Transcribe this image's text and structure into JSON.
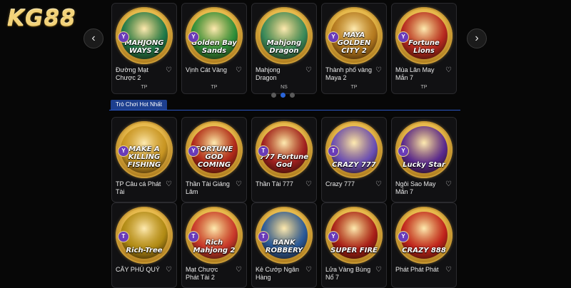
{
  "brand": {
    "logo_text": "KG88",
    "accent": "#f3d37a"
  },
  "nav": {
    "prev_icon": "chevron-left-icon",
    "next_icon": "chevron-right-icon",
    "prev_glyph": "‹",
    "next_glyph": "›"
  },
  "carousel": {
    "games": [
      {
        "thumb_text": "MAHJONG WAYS 2",
        "name": "Đường Mạt Chược 2",
        "provider": "TP",
        "chip": "Y",
        "color": "#1f7a4a"
      },
      {
        "thumb_text": "Golden Bay Sands",
        "name": "Vịnh Cát Vàng",
        "provider": "TP",
        "chip": "Y",
        "color": "#2f8f3a"
      },
      {
        "thumb_text": "Mahjong Dragon",
        "name": "Mahjong Dragon",
        "provider": "NS",
        "chip": "",
        "color": "#3a8a5a"
      },
      {
        "thumb_text": "MAYA GOLDEN CITY 2",
        "name": "Thành phố vàng Maya 2",
        "provider": "TP",
        "chip": "Y",
        "color": "#b3781e"
      },
      {
        "thumb_text": "Fortune Lions",
        "name": "Mùa Lân May Mắn 7",
        "provider": "TP",
        "chip": "Y",
        "color": "#b6281f"
      }
    ],
    "dots": 3,
    "active_dot": 1
  },
  "section": {
    "title": "Trò Chơi Hot Nhất"
  },
  "hot_games": [
    {
      "thumb_text": "MAKE A KILLING FISHING",
      "name": "TP Câu cá Phát Tài",
      "chip": "Y",
      "color": "#c89522"
    },
    {
      "thumb_text": "FORTUNE GOD COMING",
      "name": "Thần Tài Giáng Lâm",
      "chip": "Y",
      "color": "#b0291b"
    },
    {
      "thumb_text": "777 Fortune God",
      "name": "Thần Tài 777",
      "chip": "T",
      "color": "#a02020"
    },
    {
      "thumb_text": "CRAZY 777",
      "name": "Crazy 777",
      "chip": "T",
      "color": "#6b4fb5"
    },
    {
      "thumb_text": "Lucky Star",
      "name": "Ngôi Sao May Mắn 7",
      "chip": "Y",
      "color": "#5a2a8f"
    },
    {
      "thumb_text": "Rich-Tree",
      "name": "CÂY PHÚ QUÝ",
      "chip": "T",
      "color": "#b08a14"
    },
    {
      "thumb_text": "Rich Mahjong 2",
      "name": "Mạt Chược Phát Tài 2",
      "chip": "T",
      "color": "#c8372a"
    },
    {
      "thumb_text": "BANK ROBBERY",
      "name": "Kẻ Cướp Ngân Hàng",
      "chip": "T",
      "color": "#2a5a9a"
    },
    {
      "thumb_text": "SUPER FIRE",
      "name": "Lửa Vàng Bùng Nổ 7",
      "chip": "Y",
      "color": "#a81f18"
    },
    {
      "thumb_text": "CRAZY 888",
      "name": "Phát Phát Phát",
      "chip": "Y",
      "color": "#c0231c"
    }
  ],
  "icons": {
    "heart": "heart-icon",
    "heart_glyph": "♡"
  }
}
